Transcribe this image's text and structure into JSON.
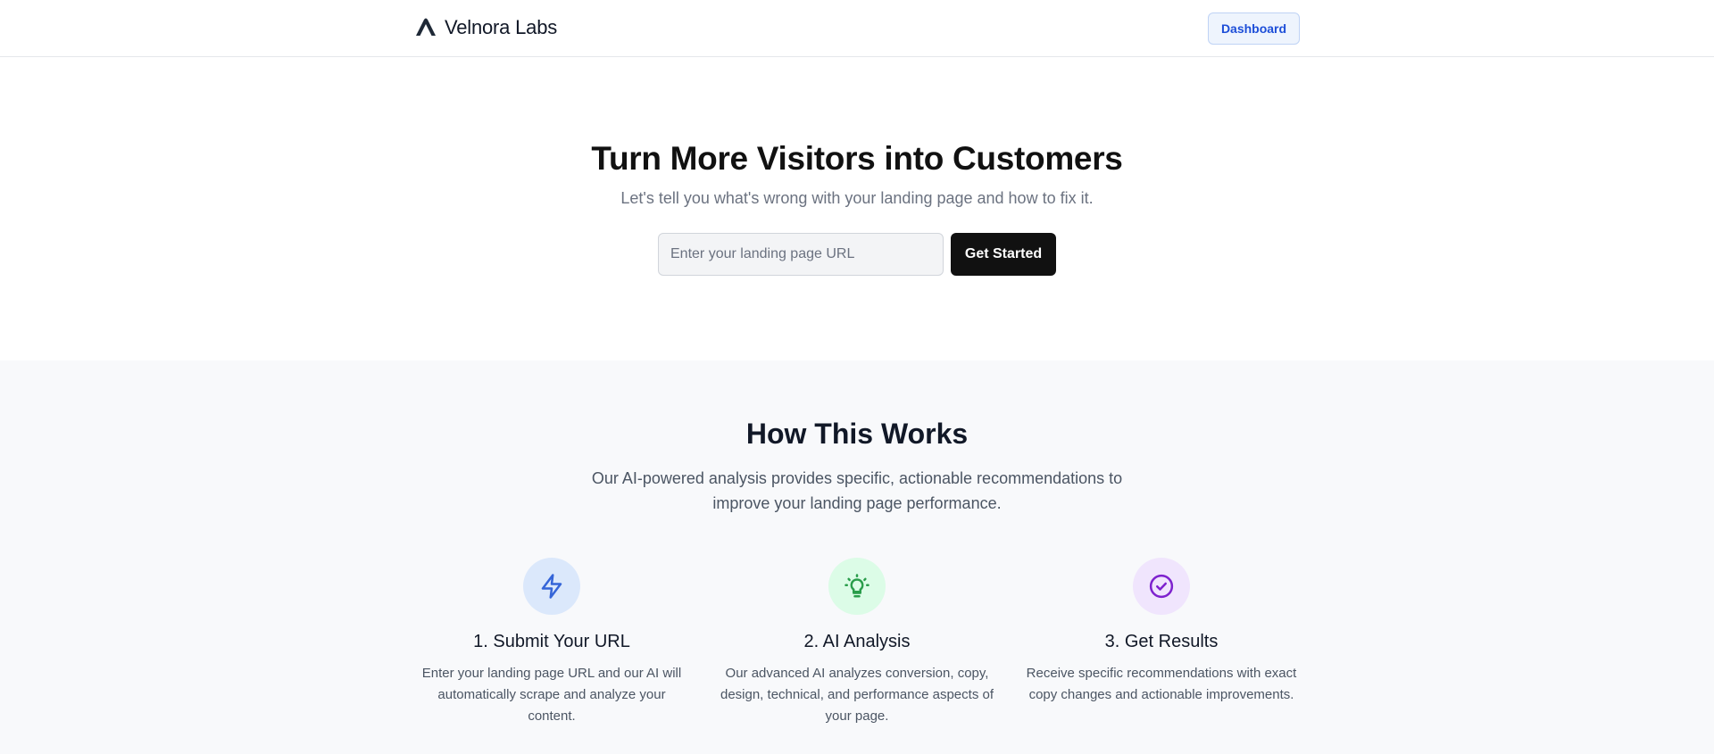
{
  "header": {
    "brand_name": "Velnora Labs",
    "brand_icon": "logo-icon",
    "dashboard_label": "Dashboard"
  },
  "hero": {
    "title": "Turn More Visitors into Customers",
    "subtitle": "Let's tell you what's wrong with your landing page and how to fix it.",
    "url_input": {
      "value": "",
      "placeholder": "Enter your landing page URL"
    },
    "cta_label": "Get Started"
  },
  "how": {
    "title": "How This Works",
    "description": "Our AI-powered analysis provides specific, actionable recommendations to improve your landing page performance.",
    "steps": [
      {
        "icon": "lightning-bolt-icon",
        "title": "1. Submit Your URL",
        "description": "Enter your landing page URL and our AI will automatically scrape and analyze your content."
      },
      {
        "icon": "lightbulb-icon",
        "title": "2. AI Analysis",
        "description": "Our advanced AI analyzes conversion, copy, design, technical, and performance aspects of your page."
      },
      {
        "icon": "check-circle-icon",
        "title": "3. Get Results",
        "description": "Receive specific recommendations with exact copy changes and actionable improvements."
      }
    ]
  },
  "colors": {
    "accent_blue": "#1d4ed8",
    "icon_blue": "#3565d8",
    "icon_green": "#2a9d4b",
    "icon_purple": "#7e22ce",
    "primary_button": "#111111"
  }
}
